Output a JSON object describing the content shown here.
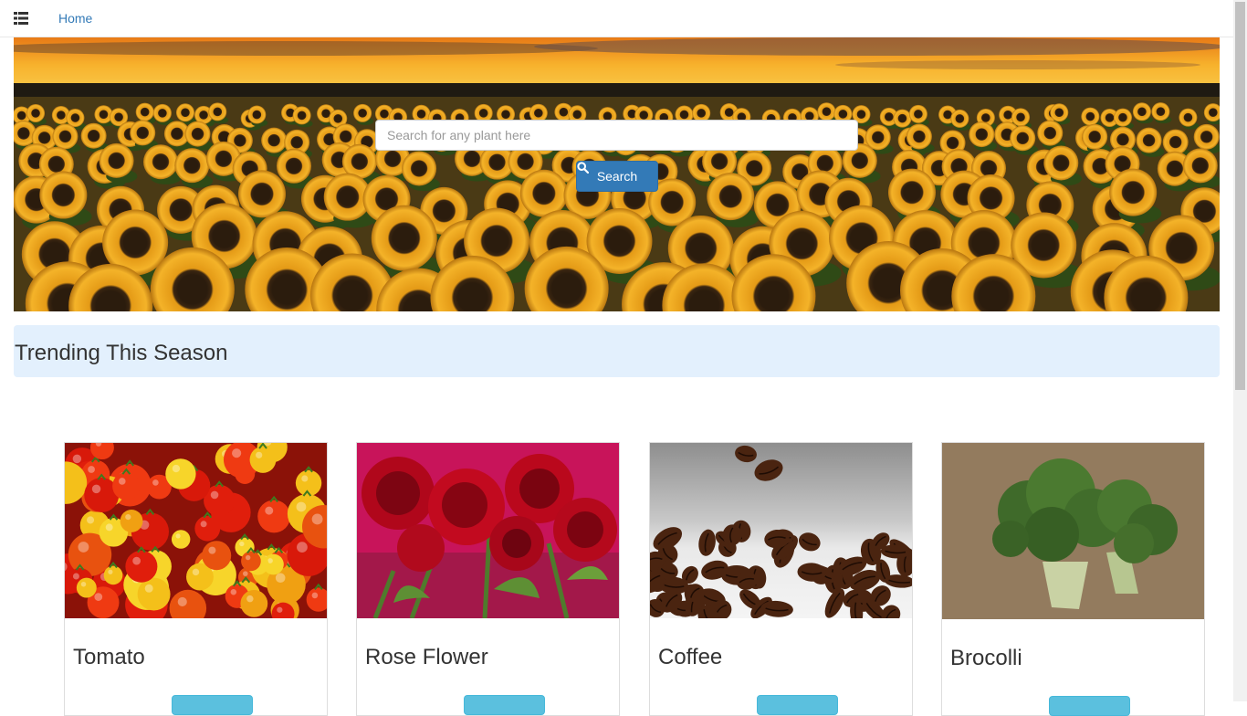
{
  "nav": {
    "menu_icon": "list-icon",
    "home_label": "Home"
  },
  "hero": {
    "search_placeholder": "Search for any plant here",
    "search_value": "",
    "search_button_label": "Search",
    "search_icon": "search-icon"
  },
  "trending": {
    "title": "Trending This Season",
    "cards": [
      {
        "title": "Tomato",
        "image": "tomatoes photo"
      },
      {
        "title": "Rose Flower",
        "image": "red roses photo"
      },
      {
        "title": "Coffee",
        "image": "coffee beans photo"
      },
      {
        "title": "Brocolli",
        "image": "broccoli photo"
      }
    ]
  },
  "colors": {
    "primary": "#337ab7",
    "info": "#5bc0de",
    "trend_bg": "#e3f0fd"
  }
}
